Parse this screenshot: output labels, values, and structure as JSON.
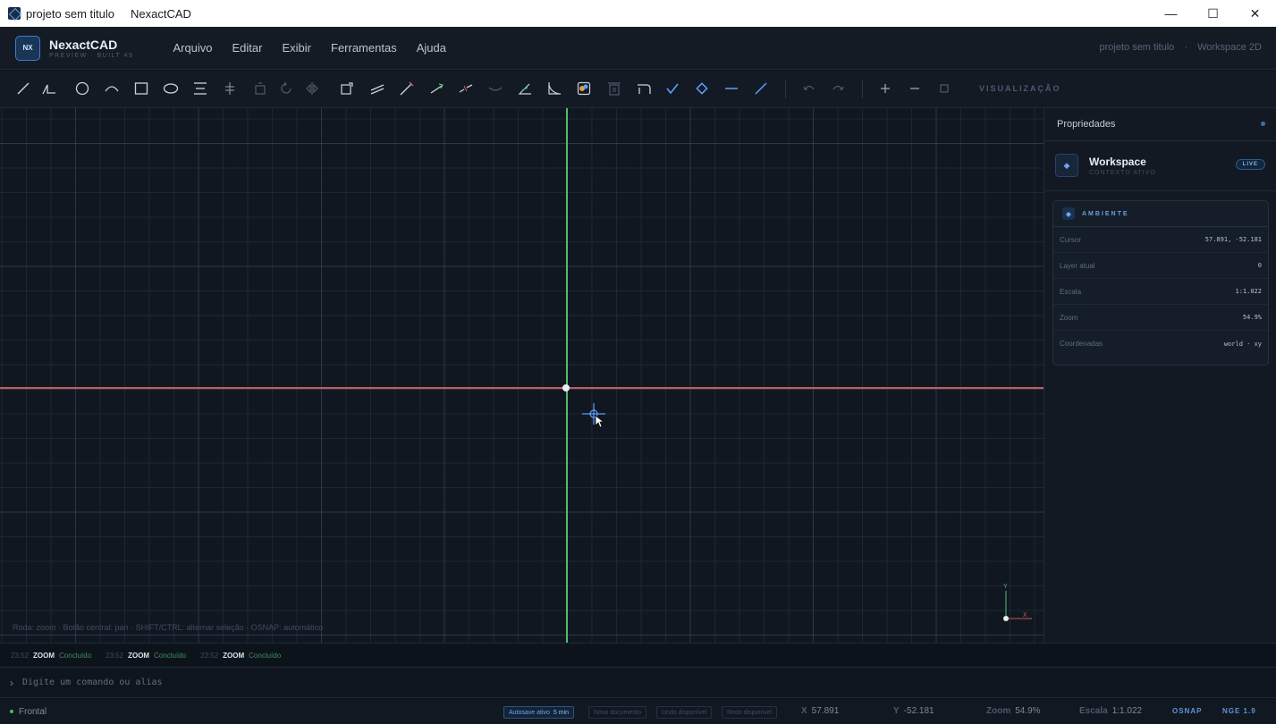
{
  "window": {
    "title": "projeto sem titulo",
    "app_name": "NexactCAD",
    "controls": {
      "minimize": "—",
      "maximize": "☐",
      "close": "✕"
    }
  },
  "brand": {
    "logo": "NX",
    "name": "NexactCAD",
    "subtitle": "PREVIEW · BUILT 49"
  },
  "menu": {
    "items": [
      "Arquivo",
      "Editar",
      "Exibir",
      "Ferramentas",
      "Ajuda"
    ]
  },
  "header_right": {
    "project": "projeto sem titulo",
    "separator": "·",
    "workspace": "Workspace 2D"
  },
  "toolbar": {
    "tools": [
      {
        "name": "line",
        "icon": "line-icon"
      },
      {
        "name": "polyline",
        "icon": "polyline-icon"
      },
      {
        "name": "circle",
        "icon": "circle-icon"
      },
      {
        "name": "arc",
        "icon": "arc-icon"
      },
      {
        "name": "rectangle",
        "icon": "rectangle-icon"
      },
      {
        "name": "ellipse",
        "icon": "ellipse-icon"
      },
      {
        "name": "text",
        "icon": "text-icon"
      },
      {
        "name": "move",
        "icon": "move-icon"
      },
      {
        "name": "copy",
        "icon": "copy-icon"
      },
      {
        "name": "rotate",
        "icon": "rotate-icon"
      },
      {
        "name": "mirror",
        "icon": "mirror-icon"
      },
      {
        "name": "scale",
        "icon": "scale-icon"
      },
      {
        "name": "offset",
        "icon": "offset-icon"
      },
      {
        "name": "trim",
        "icon": "trim-icon"
      },
      {
        "name": "extend",
        "icon": "extend-icon"
      },
      {
        "name": "break",
        "icon": "break-icon"
      },
      {
        "name": "join",
        "icon": "join-icon"
      },
      {
        "name": "angle",
        "icon": "angle-icon"
      },
      {
        "name": "fillet",
        "icon": "fillet-icon"
      },
      {
        "name": "hatch",
        "icon": "hatch-icon"
      },
      {
        "name": "delete",
        "icon": "delete-icon"
      },
      {
        "name": "chamfer",
        "icon": "chamfer-icon"
      },
      {
        "name": "check",
        "icon": "check-icon"
      },
      {
        "name": "snap-point",
        "icon": "snap-point-icon"
      },
      {
        "name": "horizontal",
        "icon": "horizontal-icon"
      },
      {
        "name": "measure",
        "icon": "measure-icon"
      },
      {
        "name": "undo",
        "icon": "undo-icon"
      },
      {
        "name": "redo",
        "icon": "redo-icon"
      },
      {
        "name": "zoom-in",
        "icon": "plus-icon"
      },
      {
        "name": "zoom-out",
        "icon": "minus-icon"
      },
      {
        "name": "zoom-fit",
        "icon": "square-icon"
      }
    ],
    "view_label": "VISUALIZAÇÃO"
  },
  "canvas": {
    "hint": "Roda: zoom  ·  Botão central: pan  ·  SHIFT/CTRL: alternar seleção  ·  OSNAP: automático",
    "ucs_x": "X",
    "ucs_y": "Y",
    "colors": {
      "x_axis": "#c45a5c",
      "y_axis": "#4fbf6a",
      "background": "#101720"
    }
  },
  "properties": {
    "title": "Propriedades",
    "workspace": {
      "icon": "layers-icon",
      "title": "Workspace",
      "subtitle": "CONTEXTO ATIVO",
      "badge": "LIVE"
    },
    "environment": {
      "label": "AMBIENTE",
      "rows": [
        {
          "key": "Cursor",
          "value": "57.891, -52.181"
        },
        {
          "key": "Layer atual",
          "value": "0"
        },
        {
          "key": "Escala",
          "value": "1:1.022"
        },
        {
          "key": "Zoom",
          "value": "54.9%"
        },
        {
          "key": "Coordenadas",
          "value": "world · xy"
        }
      ]
    }
  },
  "log": {
    "entries": [
      {
        "time": "23:52",
        "command": "ZOOM",
        "result": "Concluído"
      },
      {
        "time": "23:52",
        "command": "ZOOM",
        "result": "Concluído"
      },
      {
        "time": "23:52",
        "command": "ZOOM",
        "result": "Concluído"
      }
    ]
  },
  "command_line": {
    "prompt": "›",
    "placeholder": "Digite um comando ou alias"
  },
  "status": {
    "view": "Frontal",
    "chips": {
      "autosave_label": "Autosave ativo",
      "autosave_value": "5 min",
      "new_doc": "Novo documento",
      "undo": "Undo disponível",
      "redo": "Redo disponível"
    },
    "x_label": "X",
    "x_value": "57.891",
    "y_label": "Y",
    "y_value": "-52.181",
    "zoom_label": "Zoom",
    "zoom_value": "54.9%",
    "scale_label": "Escala",
    "scale_value": "1:1.022",
    "osnap": "OSNAP",
    "version": "NGE 1.9"
  }
}
